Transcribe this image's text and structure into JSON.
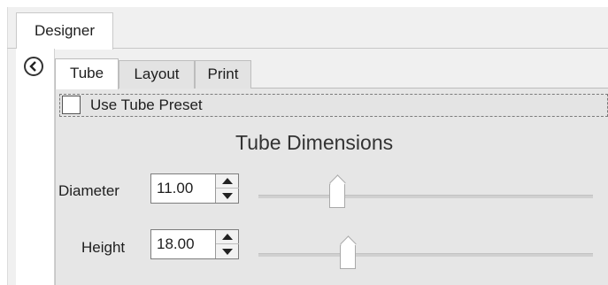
{
  "outer_tabs": [
    {
      "label": "Designer"
    }
  ],
  "inner_tabs": [
    {
      "label": "Tube",
      "selected": true
    },
    {
      "label": "Layout",
      "selected": false
    },
    {
      "label": "Print",
      "selected": false
    }
  ],
  "preset": {
    "label": "Use Tube Preset",
    "checked": false
  },
  "section_title": "Tube Dimensions",
  "fields": {
    "diameter": {
      "label": "Diameter",
      "value": "11.00",
      "slider_fraction": 0.24
    },
    "height": {
      "label": "Height",
      "value": "18.00",
      "slider_fraction": 0.27
    }
  },
  "icons": {
    "collapse": "chevron-left-icon",
    "spin_up": "triangle-up-icon",
    "spin_down": "triangle-down-icon"
  },
  "colors": {
    "panel": "#e6e6e6",
    "tab_selected": "#ffffff",
    "tab_inactive": "#e3e3e3"
  }
}
